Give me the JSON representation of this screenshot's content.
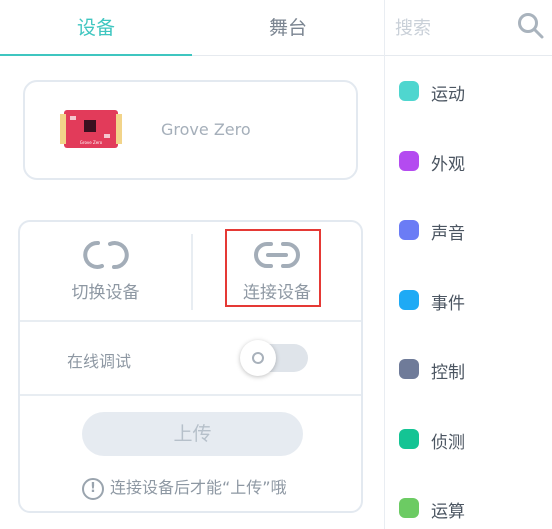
{
  "tabs": {
    "devices": "设备",
    "stage": "舞台"
  },
  "device": {
    "name": "Grove Zero",
    "board_label": "Grove Zero"
  },
  "actions": {
    "switch_label": "切换设备",
    "connect_label": "连接设备"
  },
  "debug": {
    "label": "在线调试",
    "enabled": false
  },
  "upload": {
    "label": "上传",
    "hint_icon": "!",
    "hint": "连接设备后才能“上传”哦"
  },
  "search": {
    "placeholder": "搜索"
  },
  "categories": [
    {
      "label": "运动",
      "color": "#4fd6cf"
    },
    {
      "label": "外观",
      "color": "#b44bf0"
    },
    {
      "label": "声音",
      "color": "#6b7cf5"
    },
    {
      "label": "事件",
      "color": "#1eaaf5"
    },
    {
      "label": "控制",
      "color": "#6f7b99"
    },
    {
      "label": "侦测",
      "color": "#14c494"
    },
    {
      "label": "运算",
      "color": "#6ccb63"
    }
  ],
  "colors": {
    "accent": "#3fc6c0",
    "highlight_box": "#e53935"
  }
}
